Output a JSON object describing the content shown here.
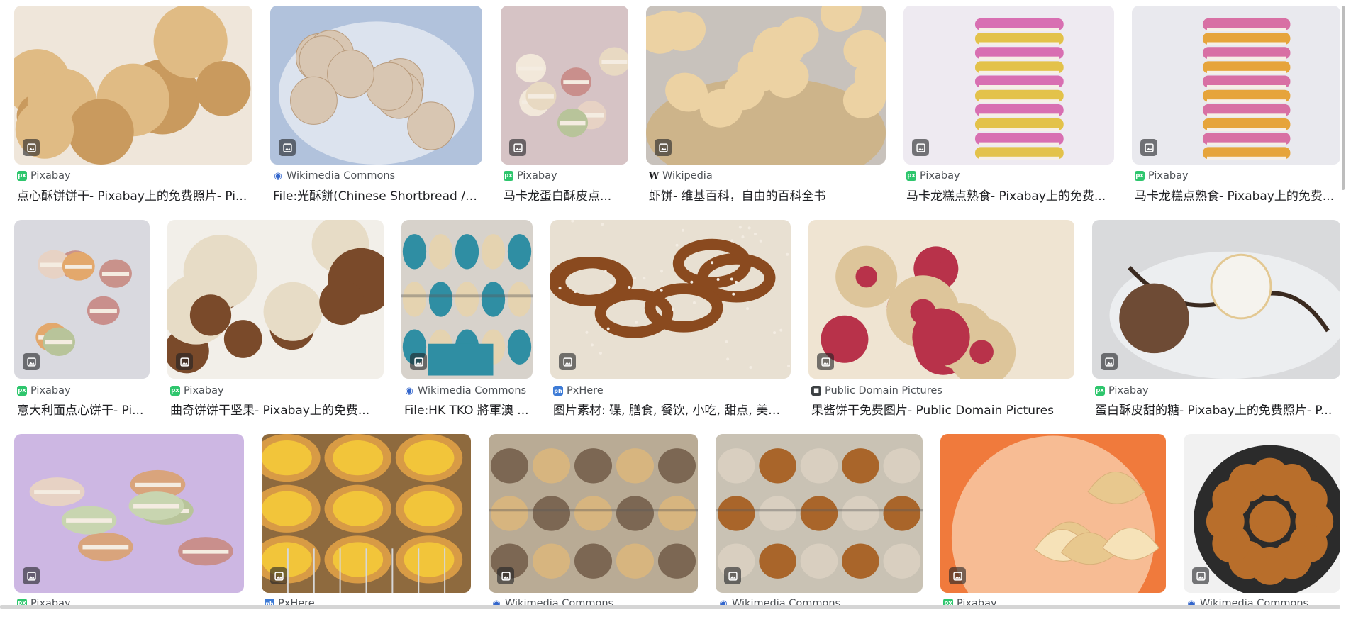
{
  "results": [
    {
      "source": "Pixabay",
      "favicon": "pixabay-icon",
      "title": "点心酥饼饼干- Pixabay上的免费照片- Pi..."
    },
    {
      "source": "Wikimedia Commons",
      "favicon": "wikimedia-icon",
      "title": "File:光酥餅(Chinese Shortbread / ..."
    },
    {
      "source": "Pixabay",
      "favicon": "pixabay-icon",
      "title": "马卡龙蛋白酥皮点..."
    },
    {
      "source": "Wikipedia",
      "favicon": "wikipedia-icon",
      "title": "虾饼- 维基百科，自由的百科全书"
    },
    {
      "source": "Pixabay",
      "favicon": "pixabay-icon",
      "title": "马卡龙糕点熟食- Pixabay上的免费..."
    },
    {
      "source": "Pixabay",
      "favicon": "pixabay-icon",
      "title": "马卡龙糕点熟食- Pixabay上的免费..."
    },
    {
      "source": "Pixabay",
      "favicon": "pixabay-icon",
      "title": "意大利面点心饼干- Pi..."
    },
    {
      "source": "Pixabay",
      "favicon": "pixabay-icon",
      "title": "曲奇饼饼干坚果- Pixabay上的免费..."
    },
    {
      "source": "Wikimedia Commons",
      "favicon": "wikimedia-icon",
      "title": "File:HK TKO 將軍澳 ..."
    },
    {
      "source": "PxHere",
      "favicon": "pxhere-icon",
      "title": "图片素材: 碟, 膳食, 餐饮, 小吃, 甜点, 美食..."
    },
    {
      "source": "Public Domain Pictures",
      "favicon": "publicdomainpictures-icon",
      "title": "果酱饼干免费图片- Public Domain Pictures"
    },
    {
      "source": "Pixabay",
      "favicon": "pixabay-icon",
      "title": "蛋白酥皮甜的糖- Pixabay上的免费照片- P..."
    },
    {
      "source": "Pixabay",
      "favicon": "pixabay-icon",
      "title": ""
    },
    {
      "source": "PxHere",
      "favicon": "pxhere-icon",
      "title": ""
    },
    {
      "source": "Wikimedia Commons",
      "favicon": "wikimedia-icon",
      "title": ""
    },
    {
      "source": "Wikimedia Commons",
      "favicon": "wikimedia-icon",
      "title": ""
    },
    {
      "source": "Pixabay",
      "favicon": "pixabay-icon",
      "title": ""
    },
    {
      "source": "Wikimedia Commons",
      "favicon": "wikimedia-icon",
      "title": ""
    }
  ],
  "thumbnails": [
    {
      "depicts": "nut-cookies",
      "colors": [
        "#efe6da",
        "#c99a5e",
        "#e0bb84"
      ]
    },
    {
      "depicts": "shortbread-buns-on-plate",
      "colors": [
        "#dce3ee",
        "#d8c6b2",
        "#2f5fa8"
      ]
    },
    {
      "depicts": "cream-macarons",
      "colors": [
        "#d6c3c5",
        "#f2e8da",
        "#e8d9c2"
      ]
    },
    {
      "depicts": "shrimp-chips-basket",
      "colors": [
        "#c8c2bc",
        "#ecd2a3",
        "#cdb48a"
      ]
    },
    {
      "depicts": "macaron-stack",
      "colors": [
        "#eeeaf1",
        "#d86fb2",
        "#e3c24a"
      ]
    },
    {
      "depicts": "macaron-stack",
      "colors": [
        "#e9e9ee",
        "#d870a4",
        "#e6a43b"
      ]
    },
    {
      "depicts": "pastel-macarons",
      "colors": [
        "#d9d9df",
        "#c9928b",
        "#e3a86c"
      ]
    },
    {
      "depicts": "powdered-cookies-hazelnuts",
      "colors": [
        "#f2efe9",
        "#e7dcc6",
        "#7a4a2a"
      ]
    },
    {
      "depicts": "packaged-shortbread",
      "colors": [
        "#d7d2cb",
        "#e5d3b0",
        "#2f8ea3"
      ]
    },
    {
      "depicts": "pretzels",
      "colors": [
        "#e8e0d2",
        "#8a4a1f",
        "#f3ece2"
      ]
    },
    {
      "depicts": "jam-cookies",
      "colors": [
        "#efe4d2",
        "#ddc59a",
        "#b8324a"
      ]
    },
    {
      "depicts": "meringue-dessert",
      "colors": [
        "#d9dadc",
        "#f5f3ee",
        "#6e4b35"
      ]
    },
    {
      "depicts": "colorful-macarons",
      "colors": [
        "#cdb7e3",
        "#d9a47c",
        "#c8d5b0"
      ]
    },
    {
      "depicts": "egg-tarts",
      "colors": [
        "#8e6a3e",
        "#f2c53a",
        "#d89b45"
      ]
    },
    {
      "depicts": "bakery-tray",
      "colors": [
        "#b9ab95",
        "#d7b57f",
        "#7c6753"
      ]
    },
    {
      "depicts": "bakery-display",
      "colors": [
        "#c9c2b4",
        "#a9652a",
        "#d9cfc0"
      ]
    },
    {
      "depicts": "fortune-cookies",
      "colors": [
        "#f07a3c",
        "#f6e2b8",
        "#e8c88e"
      ]
    },
    {
      "depicts": "sesame-cakes",
      "colors": [
        "#f1f1f1",
        "#b86e2b",
        "#3a2415"
      ]
    }
  ]
}
